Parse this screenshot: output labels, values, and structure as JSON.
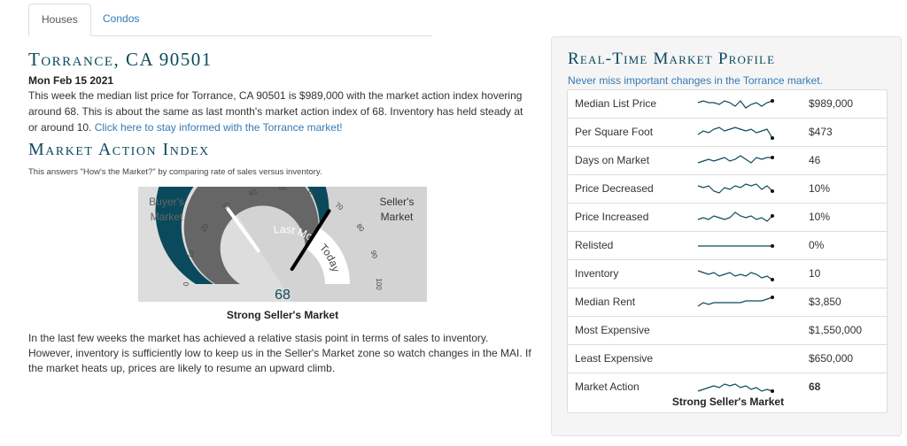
{
  "tabs": [
    {
      "label": "Houses",
      "active": true
    },
    {
      "label": "Condos",
      "active": false
    }
  ],
  "left": {
    "city_title": "Torrance, CA 90501",
    "date": "Mon Feb 15 2021",
    "summary_text": "This week the median list price for Torrance, CA 90501 is $989,000 with the market action index hovering around 68. This is about the same as last month's market action index of 68. Inventory has held steady at or around 10. ",
    "summary_link": "Click here to stay informed with the Torrance market!",
    "mai_title": "Market Action Index",
    "mai_desc": "This answers \"How's the Market?\" by comparing rate of sales versus inventory.",
    "gauge": {
      "left_label_1": "Buyer's",
      "left_label_2": "Market",
      "right_label_1": "Seller's",
      "right_label_2": "Market",
      "ticks": [
        "0",
        "10",
        "20",
        "30",
        "40",
        "50",
        "60",
        "70",
        "80",
        "90",
        "100"
      ],
      "band_last_month": "Last Month",
      "band_today": "Today",
      "value": 68,
      "value_label": "68",
      "caption": "Strong Seller's Market"
    },
    "closing": "In the last few weeks the market has achieved a relative stasis point in terms of sales to inventory. However, inventory is sufficiently low to keep us in the Seller's Market zone so watch changes in the MAI. If the market heats up, prices are likely to resume an upward climb."
  },
  "profile": {
    "title": "Real-Time Market Profile",
    "subtitle": "Never miss important changes in the Torrance market.",
    "rows": [
      {
        "label": "Median List Price",
        "value": "$989,000",
        "spark": [
          5,
          6,
          5,
          5,
          4,
          6,
          5,
          3,
          6,
          2,
          4,
          5,
          3,
          5,
          6
        ],
        "bold": false
      },
      {
        "label": "Per Square Foot",
        "value": "$473",
        "spark": [
          3,
          5,
          4,
          6,
          7,
          5,
          6,
          7,
          6,
          5,
          6,
          4,
          5,
          6,
          1
        ],
        "bold": false
      },
      {
        "label": "Days on Market",
        "value": "46",
        "spark": [
          3,
          4,
          5,
          4,
          5,
          6,
          4,
          5,
          7,
          5,
          3,
          6,
          5,
          6,
          6
        ],
        "bold": false
      },
      {
        "label": "Price Decreased",
        "value": "10%",
        "spark": [
          6,
          5,
          6,
          3,
          2,
          5,
          4,
          6,
          5,
          7,
          6,
          7,
          4,
          6,
          3
        ],
        "bold": false
      },
      {
        "label": "Price Increased",
        "value": "10%",
        "spark": [
          3,
          4,
          3,
          5,
          4,
          3,
          4,
          7,
          5,
          4,
          5,
          3,
          4,
          2,
          5
        ],
        "bold": false
      },
      {
        "label": "Relisted",
        "value": "0%",
        "spark": [
          4,
          4,
          4,
          4,
          4,
          4,
          4,
          4,
          4,
          4,
          4,
          4,
          4,
          4,
          4
        ],
        "bold": false
      },
      {
        "label": "Inventory",
        "value": "10",
        "spark": [
          6,
          5,
          4,
          5,
          3,
          4,
          5,
          3,
          4,
          3,
          5,
          4,
          2,
          3,
          1
        ],
        "bold": false
      },
      {
        "label": "Median Rent",
        "value": "$3,850",
        "spark": [
          2,
          4,
          3,
          4,
          4,
          4,
          4,
          4,
          4,
          5,
          5,
          5,
          5,
          6,
          7
        ],
        "bold": false
      },
      {
        "label": "Most Expensive",
        "value": "$1,550,000",
        "spark": null,
        "bold": false
      },
      {
        "label": "Least Expensive",
        "value": "$650,000",
        "spark": null,
        "bold": false
      },
      {
        "label": "Market Action",
        "value": "68",
        "spark": [
          2,
          3,
          4,
          5,
          4,
          6,
          5,
          6,
          4,
          5,
          3,
          4,
          2,
          3,
          2
        ],
        "bold": true,
        "caption": "Strong Seller's Market"
      }
    ]
  },
  "colors": {
    "accent": "#0b4a5c",
    "link": "#337ab7",
    "gauge_dark": "#0b4a5c",
    "gauge_mid": "#666666",
    "gauge_bg_light": "#dddddd",
    "gauge_bg_right": "#d3d3d3"
  }
}
